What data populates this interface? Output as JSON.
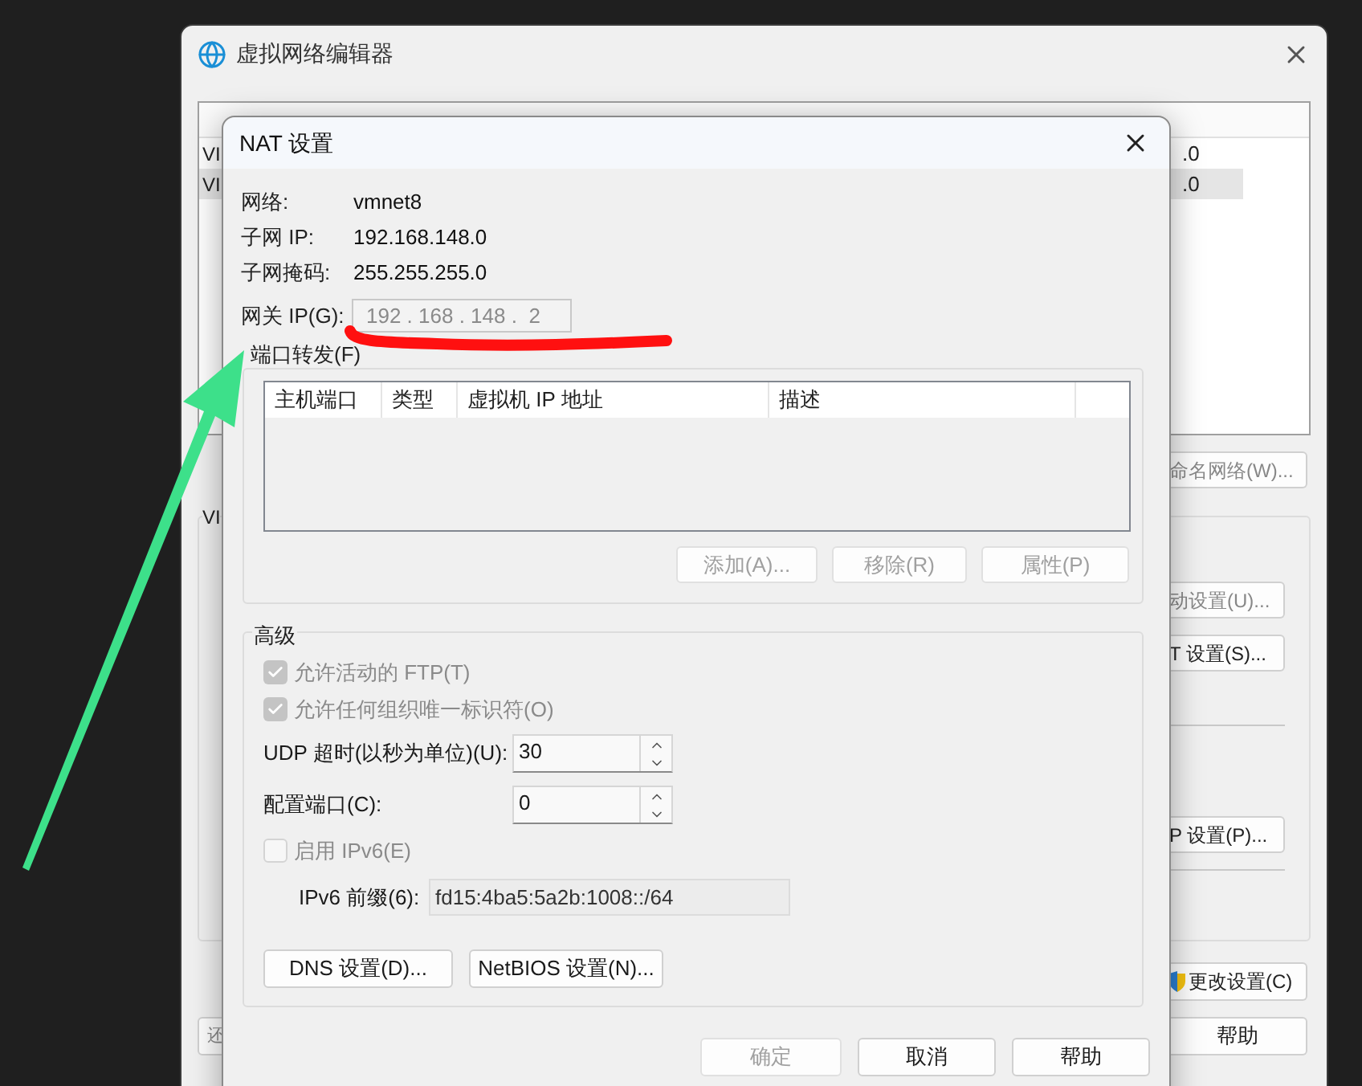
{
  "background_window": {
    "title": "虚拟网络编辑器",
    "network_list": {
      "rows": [
        {
          "name": "VI",
          "subnet": ".0",
          "selected": false
        },
        {
          "name": "VI",
          "subnet": ".0",
          "selected": true
        }
      ]
    },
    "rename_button": "命名网络(W)...",
    "settings_group": {
      "label": "VI",
      "buttons": [
        "动设置(U)...",
        "T 设置(S)...",
        "P 设置(P)..."
      ]
    },
    "change_settings_button": "更改设置(C)",
    "help_button": "帮助",
    "restore_button": "还"
  },
  "nat_dialog": {
    "title": "NAT 设置",
    "info": [
      {
        "label": "网络:",
        "value": "vmnet8"
      },
      {
        "label": "子网 IP:",
        "value": "192.168.148.0"
      },
      {
        "label": "子网掩码:",
        "value": "255.255.255.0"
      }
    ],
    "gateway": {
      "label": "网关 IP(G):",
      "value": "192 . 168 . 148 .  2",
      "disabled": true
    },
    "port_forwarding": {
      "label": "端口转发(F)",
      "columns": [
        "主机端口",
        "类型",
        "虚拟机 IP 地址",
        "描述"
      ],
      "buttons": [
        {
          "label": "添加(A)...",
          "disabled": true
        },
        {
          "label": "移除(R)",
          "disabled": true
        },
        {
          "label": "属性(P)",
          "disabled": true
        }
      ]
    },
    "advanced": {
      "label": "高级",
      "options": [
        {
          "kind": "checkbox",
          "label": "允许活动的 FTP(T)",
          "checked": true,
          "disabled": true
        },
        {
          "kind": "checkbox",
          "label": "允许任何组织唯一标识符(O)",
          "checked": true,
          "disabled": true
        },
        {
          "kind": "spinner",
          "label": "UDP 超时(以秒为单位)(U):",
          "value": "30"
        },
        {
          "kind": "spinner",
          "label": "配置端口(C):",
          "value": "0"
        },
        {
          "kind": "checkbox",
          "label": "启用 IPv6(E)",
          "checked": false,
          "disabled": true
        },
        {
          "kind": "text",
          "label": "IPv6 前缀(6):",
          "value": "fd15:4ba5:5a2b:1008::/64",
          "disabled": true
        }
      ],
      "buttons": [
        "DNS 设置(D)...",
        "NetBIOS 设置(N)..."
      ]
    },
    "footer_buttons": [
      {
        "label": "确定",
        "disabled": true
      },
      {
        "label": "取消",
        "disabled": false
      },
      {
        "label": "帮助",
        "disabled": false
      }
    ]
  }
}
